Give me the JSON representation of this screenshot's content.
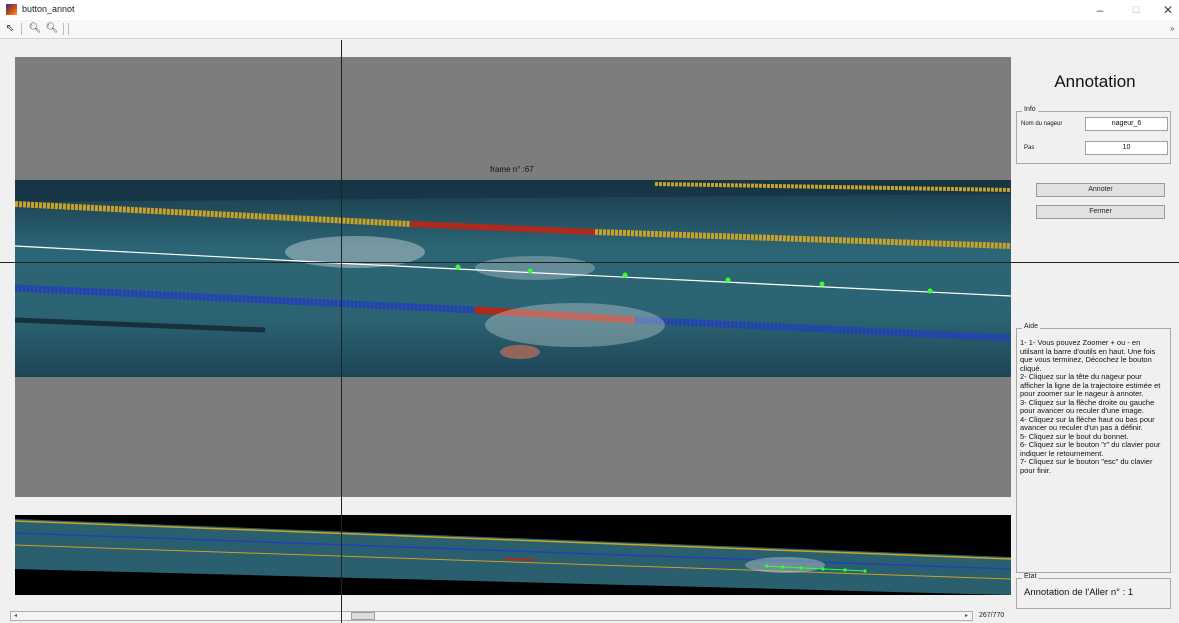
{
  "window": {
    "title": "button_annot",
    "min_glyph": "–",
    "max_glyph": "☐",
    "close_glyph": "✕"
  },
  "toolbar": {
    "pointer_glyph": "⇖",
    "zoom_in_glyph": "🔍︎",
    "zoom_out_glyph": "🔍︎",
    "overflow_glyph": "»"
  },
  "viewer": {
    "frame_label": "frame n° :67",
    "frame_counter": "267/770",
    "scroll_left_glyph": "◂",
    "scroll_right_glyph": "▸"
  },
  "panel": {
    "title": "Annotation",
    "info": {
      "legend": "Info",
      "swimmer_label": "Nom du nageur",
      "swimmer_value": "nageur_6",
      "step_label": "Pas",
      "step_value": "10"
    },
    "buttons": {
      "annotate": "Annoter",
      "close": "Fermer"
    },
    "aide": {
      "legend": "Aide",
      "text": "1- 1- Vous pouvez Zoomer + ou - en utilsant la barre d'outils en haut. Une fois que vous terminez, Décochez le bouton cliqué.\n2- Cliquez sur la tête du nageur pour afficher la ligne de la trajectoire estimée et pour zoomer sur le nageur à annoter.\n3- Cliquez sur la flèche droite ou gauche pour avancer ou reculer d'une image.\n4- Cliquez sur la flèche haut ou bas pour avancer ou reculer d'un pas à définir.\n5- Cliquez sur le bout du bonnet.\n6- Cliquez sur le bouton \"r\" du clavier pour indiquer le retournement.\n7- Cliquez sur le bouton \"esc\" du clavier pour finir."
    },
    "etat": {
      "legend": "Etat",
      "text": "Annotation de l'Aller n° : 1"
    }
  },
  "colors": {
    "trajectory": "#ffffff",
    "annotation_points": "#33ff33",
    "lane_yellow": "#c9a227",
    "lane_blue": "#2340b8",
    "lane_red": "#b02a1c"
  }
}
